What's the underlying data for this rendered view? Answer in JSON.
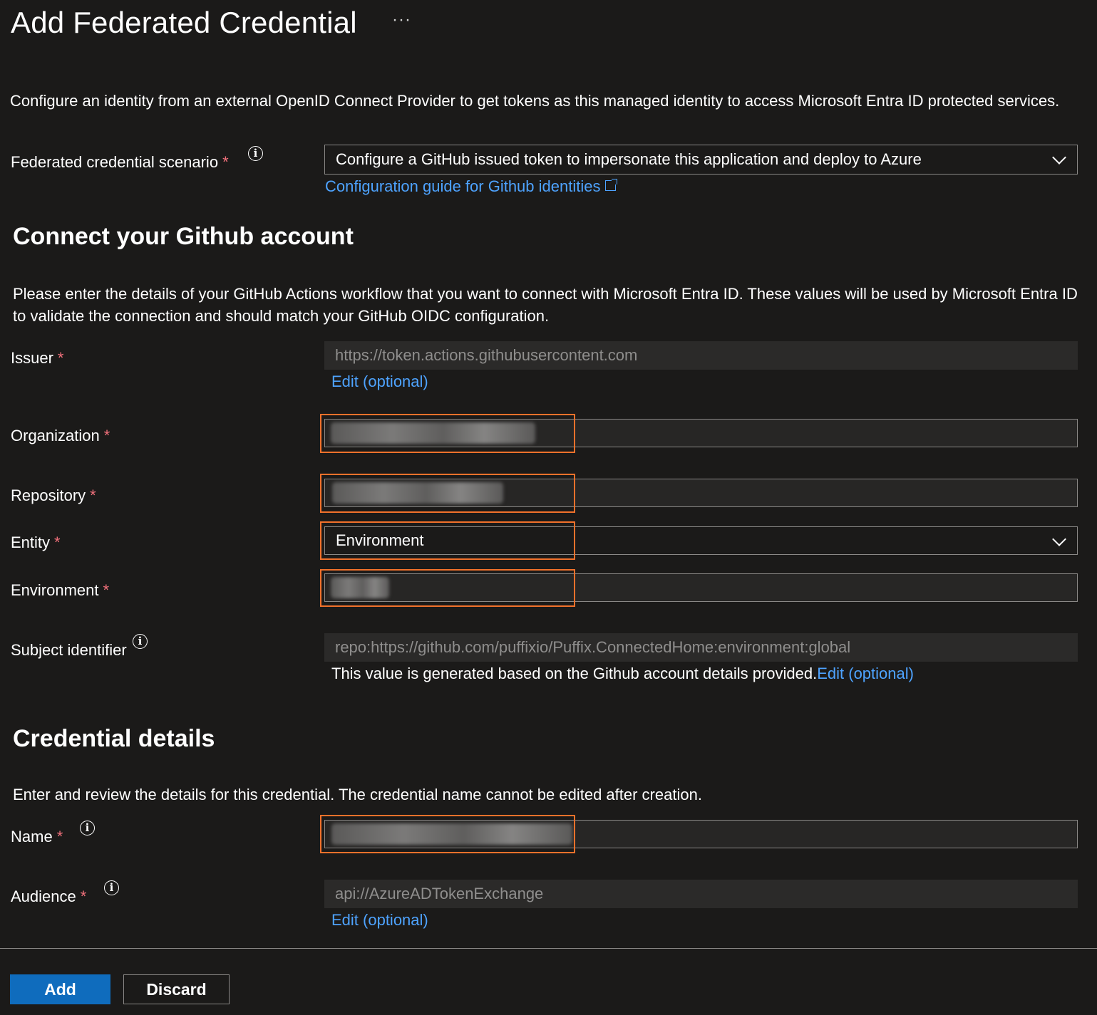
{
  "header": {
    "title": "Add Federated Credential",
    "more_label": "···"
  },
  "intro": "Configure an identity from an external OpenID Connect Provider to get tokens as this managed identity to access Microsoft Entra ID protected services.",
  "scenario": {
    "label": "Federated credential scenario",
    "value": "Configure a GitHub issued token to impersonate this application and deploy to Azure",
    "guide_link": "Configuration guide for Github identities"
  },
  "github": {
    "heading": "Connect your Github account",
    "description": "Please enter the details of your GitHub Actions workflow that you want to connect with Microsoft Entra ID. These values will be used by Microsoft Entra ID to validate the connection and should match your GitHub OIDC configuration.",
    "issuer": {
      "label": "Issuer",
      "value": "https://token.actions.githubusercontent.com",
      "edit": "Edit (optional)"
    },
    "organization": {
      "label": "Organization"
    },
    "repository": {
      "label": "Repository"
    },
    "entity": {
      "label": "Entity",
      "value": "Environment"
    },
    "environment": {
      "label": "Environment"
    },
    "subject": {
      "label": "Subject identifier",
      "value": "repo:https://github.com/puffixio/Puffix.ConnectedHome:environment:global",
      "helper": "This value is generated based on the Github account details provided.",
      "edit": "Edit (optional)"
    }
  },
  "credential": {
    "heading": "Credential details",
    "description": "Enter and review the details for this credential. The credential name cannot be edited after creation.",
    "name": {
      "label": "Name"
    },
    "audience": {
      "label": "Audience",
      "value": "api://AzureADTokenExchange",
      "edit": "Edit (optional)"
    }
  },
  "footer": {
    "add": "Add",
    "discard": "Discard"
  },
  "required_marker": "*",
  "info_glyph": "i",
  "colors": {
    "accent": "#0f6cbd",
    "link": "#4ea3ff",
    "highlight": "#f1712b",
    "required": "#f1707b",
    "background": "#1b1a19"
  }
}
